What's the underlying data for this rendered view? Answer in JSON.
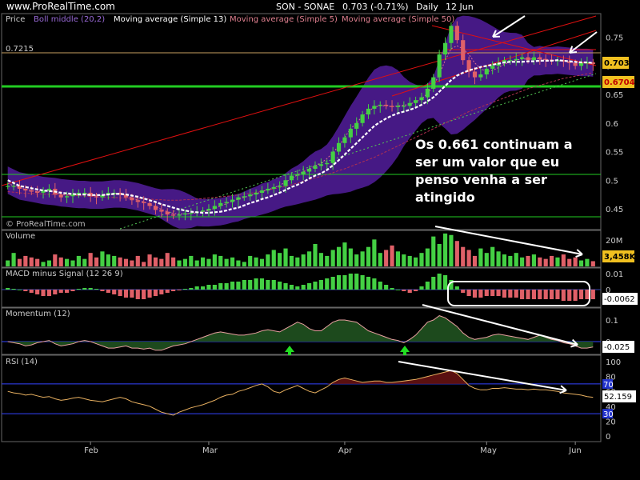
{
  "header": {
    "site": "www.ProRealTime.com",
    "ticker": "SON - SONAE",
    "price": "0.703 (-0.71%)",
    "period": "Daily",
    "date": "12 Jun"
  },
  "annotation": {
    "lines": [
      "Os 0.661 continuam a",
      "ser um valor que eu",
      "penso venha a ser",
      "atingido"
    ]
  },
  "colors": {
    "up": "#44d044",
    "down": "#e06068",
    "band": "#4a1a8c",
    "annotation_lines": "#ffffff",
    "support": "#22cc22",
    "trend": "#e01010"
  },
  "chart_data": [
    {
      "type": "candlestick",
      "panel": "Price",
      "legend": [
        "Price",
        "Boll middle (20,2)",
        "Moving average (Simple 13)",
        "Moving average (Simple 5)",
        "Moving average (Simple 50)"
      ],
      "watermark": "© ProRealTime.com",
      "x_labels": [
        "Feb",
        "Mar",
        "Apr",
        "May",
        "Jun"
      ],
      "y_ticks": [
        0.45,
        0.5,
        0.55,
        0.6,
        0.65,
        0.7,
        0.75
      ],
      "ylim": [
        0.415,
        0.79
      ],
      "level_label": "0.7215",
      "badges": [
        "0.703",
        "0.6704"
      ],
      "close": [
        0.49,
        0.49,
        0.485,
        0.482,
        0.48,
        0.478,
        0.482,
        0.485,
        0.475,
        0.47,
        0.472,
        0.475,
        0.478,
        0.478,
        0.472,
        0.47,
        0.474,
        0.478,
        0.478,
        0.475,
        0.47,
        0.465,
        0.462,
        0.46,
        0.455,
        0.448,
        0.445,
        0.44,
        0.438,
        0.44,
        0.442,
        0.443,
        0.445,
        0.447,
        0.45,
        0.455,
        0.46,
        0.462,
        0.466,
        0.47,
        0.472,
        0.475,
        0.478,
        0.482,
        0.485,
        0.488,
        0.49,
        0.5,
        0.508,
        0.51,
        0.515,
        0.52,
        0.525,
        0.528,
        0.53,
        0.55,
        0.565,
        0.575,
        0.59,
        0.6,
        0.615,
        0.625,
        0.63,
        0.632,
        0.63,
        0.628,
        0.63,
        0.63,
        0.635,
        0.64,
        0.645,
        0.66,
        0.68,
        0.72,
        0.74,
        0.77,
        0.745,
        0.71,
        0.69,
        0.68,
        0.685,
        0.695,
        0.7,
        0.705,
        0.71,
        0.71,
        0.712,
        0.715,
        0.71,
        0.715,
        0.712,
        0.71,
        0.708,
        0.71,
        0.708,
        0.705,
        0.7,
        0.705,
        0.706,
        0.703
      ],
      "series": [
        {
          "name": "Moving average (Simple 13)",
          "values": [
            0.5,
            0.495,
            0.49,
            0.488,
            0.486,
            0.484,
            0.482,
            0.481,
            0.48,
            0.478,
            0.477,
            0.476,
            0.475,
            0.475,
            0.474,
            0.474,
            0.474,
            0.475,
            0.476,
            0.476,
            0.475,
            0.473,
            0.471,
            0.468,
            0.465,
            0.462,
            0.458,
            0.455,
            0.452,
            0.449,
            0.447,
            0.445,
            0.444,
            0.443,
            0.443,
            0.444,
            0.445,
            0.447,
            0.45,
            0.452,
            0.456,
            0.46,
            0.463,
            0.467,
            0.47,
            0.474,
            0.478,
            0.483,
            0.488,
            0.492,
            0.497,
            0.503,
            0.508,
            0.512,
            0.518,
            0.526,
            0.535,
            0.545,
            0.555,
            0.565,
            0.575,
            0.585,
            0.595,
            0.602,
            0.608,
            0.613,
            0.617,
            0.62,
            0.623,
            0.627,
            0.632,
            0.638,
            0.645,
            0.655,
            0.665,
            0.675,
            0.683,
            0.688,
            0.692,
            0.695,
            0.698,
            0.7,
            0.702,
            0.704,
            0.706,
            0.707,
            0.707,
            0.707,
            0.708,
            0.708,
            0.709,
            0.709,
            0.709,
            0.71,
            0.709,
            0.708,
            0.707,
            0.706,
            0.706,
            0.705
          ]
        },
        {
          "name": "Moving average (Simple 5)",
          "values": [
            0.495,
            0.49,
            0.487,
            0.484,
            0.482,
            0.48,
            0.481,
            0.482,
            0.479,
            0.475,
            0.474,
            0.474,
            0.475,
            0.476,
            0.475,
            0.473,
            0.473,
            0.475,
            0.476,
            0.476,
            0.473,
            0.469,
            0.465,
            0.462,
            0.458,
            0.454,
            0.449,
            0.445,
            0.442,
            0.441,
            0.441,
            0.442,
            0.443,
            0.445,
            0.447,
            0.451,
            0.455,
            0.459,
            0.463,
            0.467,
            0.47,
            0.473,
            0.476,
            0.48,
            0.483,
            0.487,
            0.491,
            0.497,
            0.503,
            0.509,
            0.515,
            0.52,
            0.525,
            0.53,
            0.538,
            0.548,
            0.56,
            0.575,
            0.59,
            0.6,
            0.612,
            0.62,
            0.628,
            0.63,
            0.63,
            0.629,
            0.63,
            0.631,
            0.633,
            0.637,
            0.642,
            0.652,
            0.665,
            0.685,
            0.71,
            0.73,
            0.735,
            0.73,
            0.72,
            0.705,
            0.695,
            0.69,
            0.692,
            0.697,
            0.703,
            0.707,
            0.71,
            0.712,
            0.712,
            0.712,
            0.712,
            0.711,
            0.71,
            0.709,
            0.708,
            0.707,
            0.705,
            0.705,
            0.705,
            0.704
          ]
        },
        {
          "name": "Moving average (Simple 50)",
          "values": [
            0.48,
            0.479,
            0.478,
            0.477,
            0.477,
            0.476,
            0.476,
            0.475,
            0.475,
            0.474,
            0.474,
            0.473,
            0.473,
            0.472,
            0.472,
            0.471,
            0.471,
            0.47,
            0.47,
            0.469,
            0.469,
            0.468,
            0.468,
            0.467,
            0.467,
            0.466,
            0.466,
            0.465,
            0.465,
            0.465,
            0.466,
            0.466,
            0.467,
            0.468,
            0.469,
            0.47,
            0.471,
            0.472,
            0.473,
            0.474,
            0.476,
            0.477,
            0.479,
            0.481,
            0.483,
            0.485,
            0.487,
            0.489,
            0.492,
            0.495,
            0.498,
            0.501,
            0.504,
            0.507,
            0.51,
            0.513,
            0.517,
            0.52,
            0.524,
            0.528,
            0.532,
            0.536,
            0.54,
            0.545,
            0.55,
            0.555,
            0.56,
            0.565,
            0.57,
            0.575,
            0.58,
            0.585,
            0.59,
            0.595,
            0.6,
            0.605,
            0.61,
            0.615,
            0.62,
            0.624,
            0.628,
            0.632,
            0.636,
            0.64,
            0.644,
            0.648,
            0.652,
            0.656,
            0.66,
            0.663,
            0.666,
            0.669,
            0.672,
            0.675,
            0.678,
            0.68,
            0.682,
            0.684,
            0.686,
            0.688
          ]
        }
      ]
    },
    {
      "type": "bar",
      "panel": "Volume",
      "y_ticks_label": "20M",
      "badge": "3,458K",
      "values": [
        4,
        9,
        5,
        7,
        6,
        5,
        3,
        4,
        8,
        6,
        5,
        4,
        7,
        5,
        9,
        6,
        10,
        8,
        7,
        6,
        5,
        4,
        7,
        3,
        8,
        6,
        5,
        9,
        6,
        4,
        5,
        7,
        4,
        6,
        5,
        8,
        7,
        5,
        6,
        4,
        3,
        7,
        6,
        5,
        8,
        11,
        9,
        12,
        7,
        6,
        8,
        10,
        15,
        9,
        7,
        11,
        13,
        16,
        12,
        8,
        10,
        13,
        18,
        9,
        11,
        14,
        10,
        8,
        7,
        6,
        9,
        12,
        20,
        15,
        22,
        21,
        17,
        13,
        11,
        7,
        12,
        9,
        13,
        10,
        8,
        7,
        9,
        6,
        7,
        8,
        6,
        5,
        7,
        6,
        8,
        5,
        6,
        4,
        5,
        3.5
      ],
      "up_down": "up bars green, down bars red"
    },
    {
      "type": "bar",
      "panel": "MACD minus Signal (12 26 9)",
      "y_ticks": [
        0.01,
        0
      ],
      "badge": "-0.0062",
      "values": [
        0.001,
        0.0005,
        0,
        -0.001,
        -0.002,
        -0.003,
        -0.004,
        -0.004,
        -0.003,
        -0.002,
        -0.002,
        -0.001,
        0.0005,
        0.001,
        0.001,
        0.0005,
        -0.001,
        -0.002,
        -0.003,
        -0.004,
        -0.005,
        -0.005,
        -0.006,
        -0.006,
        -0.005,
        -0.004,
        -0.003,
        -0.002,
        -0.001,
        -0.0005,
        0.0005,
        0.001,
        0.002,
        0.002,
        0.003,
        0.003,
        0.004,
        0.004,
        0.005,
        0.005,
        0.006,
        0.006,
        0.007,
        0.007,
        0.006,
        0.006,
        0.005,
        0.004,
        0.003,
        0.002,
        0.003,
        0.004,
        0.005,
        0.006,
        0.007,
        0.008,
        0.009,
        0.009,
        0.01,
        0.01,
        0.009,
        0.008,
        0.007,
        0.005,
        0.003,
        0.001,
        0,
        -0.001,
        -0.002,
        -0.001,
        0.002,
        0.005,
        0.008,
        0.01,
        0.009,
        0.006,
        0.002,
        -0.002,
        -0.004,
        -0.005,
        -0.005,
        -0.004,
        -0.004,
        -0.004,
        -0.005,
        -0.005,
        -0.005,
        -0.006,
        -0.006,
        -0.006,
        -0.006,
        -0.006,
        -0.006,
        -0.006,
        -0.007,
        -0.007,
        -0.007,
        -0.006,
        -0.006,
        -0.006
      ]
    },
    {
      "type": "area",
      "panel": "Momentum (12)",
      "y_ticks": [
        0.1,
        0
      ],
      "badge": "-0.025",
      "values": [
        0,
        -0.005,
        -0.01,
        -0.02,
        -0.015,
        -0.005,
        0,
        0.005,
        -0.01,
        -0.02,
        -0.015,
        -0.01,
        0,
        0.005,
        0,
        -0.01,
        -0.02,
        -0.03,
        -0.03,
        -0.025,
        -0.02,
        -0.03,
        -0.03,
        -0.035,
        -0.03,
        -0.04,
        -0.04,
        -0.03,
        -0.02,
        -0.015,
        -0.01,
        0,
        0.01,
        0.02,
        0.03,
        0.04,
        0.045,
        0.04,
        0.035,
        0.03,
        0.03,
        0.035,
        0.04,
        0.05,
        0.055,
        0.05,
        0.045,
        0.06,
        0.075,
        0.09,
        0.08,
        0.06,
        0.05,
        0.05,
        0.07,
        0.09,
        0.1,
        0.1,
        0.095,
        0.09,
        0.07,
        0.05,
        0.04,
        0.03,
        0.02,
        0.01,
        0.005,
        -0.005,
        0.01,
        0.03,
        0.06,
        0.09,
        0.1,
        0.12,
        0.11,
        0.09,
        0.07,
        0.04,
        0.02,
        0.01,
        0.015,
        0.02,
        0.03,
        0.035,
        0.03,
        0.025,
        0.02,
        0.015,
        0.01,
        0.02,
        0.03,
        0.02,
        0.01,
        0.005,
        -0.005,
        -0.01,
        -0.02,
        -0.03,
        -0.03,
        -0.025
      ],
      "markers": [
        "buy arrow near Apr",
        "buy arrow near May"
      ]
    },
    {
      "type": "line",
      "panel": "RSI (14)",
      "y_ticks": [
        100,
        80,
        60,
        40,
        20,
        0
      ],
      "levels": [
        70,
        30
      ],
      "badge": "52.159",
      "values": [
        60,
        58,
        57,
        55,
        56,
        54,
        52,
        53,
        50,
        48,
        49,
        51,
        52,
        50,
        48,
        47,
        46,
        48,
        50,
        52,
        50,
        46,
        44,
        42,
        40,
        36,
        32,
        30,
        28,
        32,
        35,
        38,
        40,
        42,
        45,
        48,
        52,
        55,
        56,
        60,
        62,
        65,
        68,
        70,
        66,
        60,
        58,
        62,
        65,
        68,
        64,
        60,
        58,
        62,
        66,
        72,
        76,
        78,
        76,
        74,
        72,
        73,
        74,
        74,
        72,
        72,
        73,
        74,
        75,
        76,
        78,
        80,
        82,
        84,
        86,
        88,
        84,
        76,
        68,
        64,
        62,
        62,
        64,
        64,
        65,
        64,
        63,
        63,
        62,
        63,
        62,
        62,
        61,
        60,
        58,
        57,
        56,
        55,
        53,
        52
      ]
    }
  ]
}
